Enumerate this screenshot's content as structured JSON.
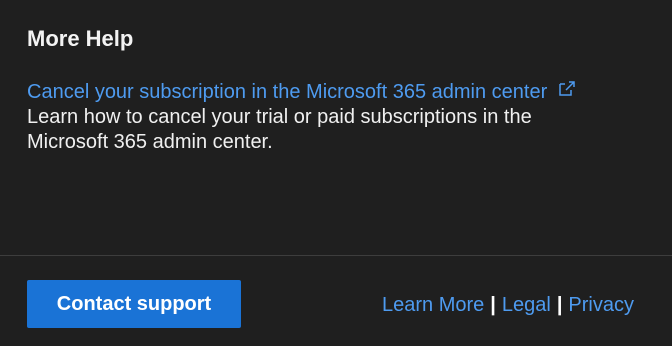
{
  "panel": {
    "title": "More Help"
  },
  "help_item": {
    "link_text": "Cancel your subscription in the Microsoft 365 admin center",
    "description": "Learn how to cancel your trial or paid subscriptions in the Microsoft 365 admin center.",
    "link_icon": "external-link-icon"
  },
  "footer": {
    "contact_button_label": "Contact support",
    "links": [
      "Learn More",
      "Legal",
      "Privacy"
    ],
    "separator": "|"
  },
  "colors": {
    "background": "#1f1f1f",
    "link": "#4e9bf0",
    "button": "#1a73d6",
    "divider": "#3d3d3d",
    "text": "#f0f0f0"
  }
}
